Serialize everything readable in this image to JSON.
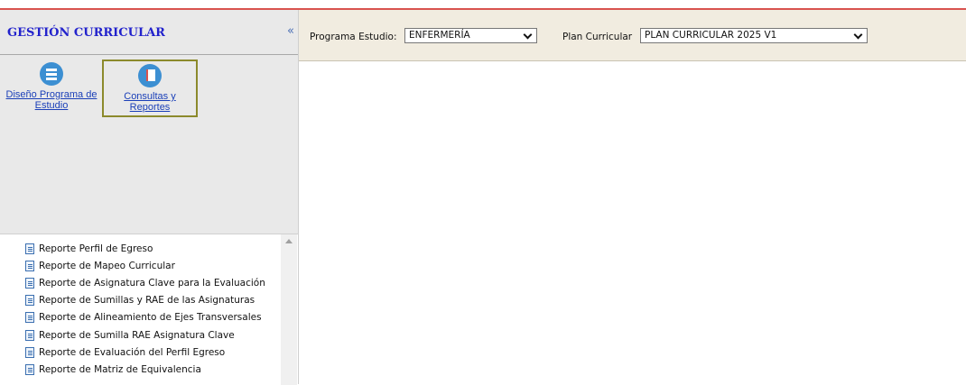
{
  "sidebar": {
    "title": "GESTIÓN CURRICULAR",
    "collapse": "«",
    "modules": [
      {
        "label": "Diseño Programa de Estudio",
        "icon": "list-icon"
      },
      {
        "label": "Consultas y Reportes",
        "icon": "books-icon"
      }
    ],
    "reports": [
      "Reporte Perfil de Egreso",
      "Reporte de Mapeo Curricular",
      "Reporte de Asignatura Clave para la Evaluación",
      "Reporte de Sumillas y RAE de las Asignaturas",
      "Reporte de Alineamiento de Ejes Transversales",
      "Reporte de Sumilla RAE Asignatura Clave",
      "Reporte de Evaluación del Perfil Egreso",
      "Reporte de Matriz de Equivalencia"
    ]
  },
  "filters": {
    "programa_label": "Programa Estudio:",
    "programa_value": "ENFERMERÍA",
    "plan_label": "Plan Curricular",
    "plan_value": "PLAN CURRICULAR 2025 V1"
  },
  "colors": {
    "accent_line": "#d9534f",
    "title": "#2222cc",
    "link": "#1a3fb8",
    "topbar_bg": "#f1ece0"
  }
}
